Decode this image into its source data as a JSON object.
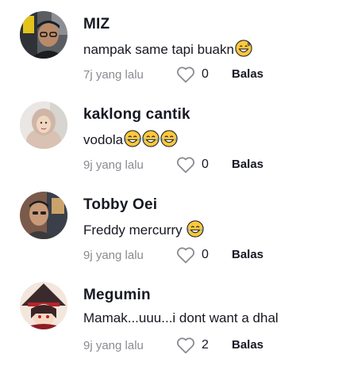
{
  "comments": [
    {
      "username": "MIZ",
      "text": "nampak same tapi buakn",
      "emojis": [
        "grin-sweat-emoji"
      ],
      "time": "7j yang lalu",
      "likes": "0",
      "reply_label": "Balas"
    },
    {
      "username": "kaklong cantik",
      "text": "vodola",
      "emojis": [
        "tears-of-joy-emoji",
        "tears-of-joy-emoji",
        "tears-of-joy-emoji"
      ],
      "time": "9j yang lalu",
      "likes": "0",
      "reply_label": "Balas"
    },
    {
      "username": "Tobby Oei",
      "text": "Freddy mercurry ",
      "emojis": [
        "tears-of-joy-emoji"
      ],
      "time": "9j yang lalu",
      "likes": "0",
      "reply_label": "Balas"
    },
    {
      "username": "Megumin",
      "text": "Mamak...uuu...i dont want a dhal",
      "emojis": [],
      "time": "9j yang lalu",
      "likes": "2",
      "reply_label": "Balas"
    }
  ],
  "colors": {
    "text": "#161823",
    "muted": "#8a8b91",
    "emoji_face": "#FFC83D"
  }
}
